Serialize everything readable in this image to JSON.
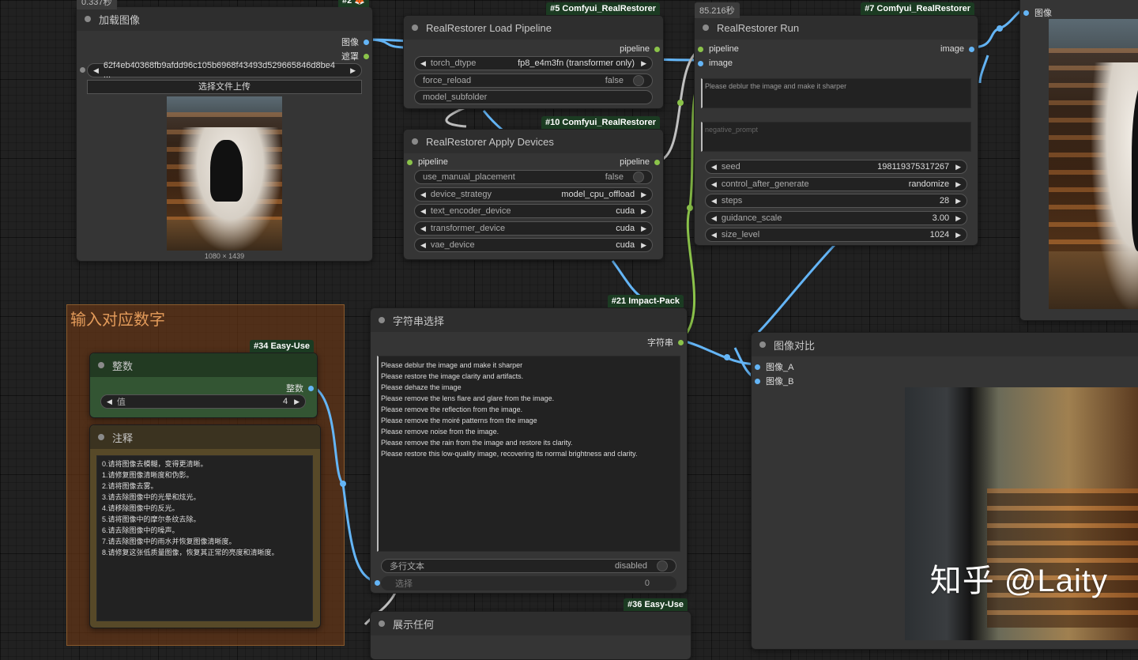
{
  "load_image": {
    "timer": "0.337秒",
    "badge": "#2 ",
    "title": "加载图像",
    "outputs": [
      "图像",
      "遮罩"
    ],
    "file_value": "62f4eb40368fb9afdd96c105b6968f43493d529665846d8be4 ...",
    "upload_label": "选择文件上传",
    "image_size": "1080 × 1439"
  },
  "load_pipeline": {
    "badge": "#5 Comfyui_RealRestorer",
    "title": "RealRestorer Load Pipeline",
    "output": "pipeline",
    "widgets": [
      {
        "label": "torch_dtype",
        "value": "fp8_e4m3fn (transformer only)"
      },
      {
        "label": "force_reload",
        "value": "false"
      },
      {
        "label": "model_subfolder",
        "value": ""
      }
    ]
  },
  "apply_devices": {
    "badge": "#10 Comfyui_RealRestorer",
    "title": "RealRestorer Apply Devices",
    "input": "pipeline",
    "output": "pipeline",
    "widgets": [
      {
        "label": "use_manual_placement",
        "value": "false"
      },
      {
        "label": "device_strategy",
        "value": "model_cpu_offload"
      },
      {
        "label": "text_encoder_device",
        "value": "cuda"
      },
      {
        "label": "transformer_device",
        "value": "cuda"
      },
      {
        "label": "vae_device",
        "value": "cuda"
      }
    ]
  },
  "run": {
    "timer": "85.216秒",
    "badge": "#7 Comfyui_RealRestorer",
    "title": "RealRestorer Run",
    "inputs": [
      "pipeline",
      "image"
    ],
    "output": "image",
    "prompt": "Please deblur the image and make it sharper",
    "negative_placeholder": "negative_prompt",
    "widgets": [
      {
        "label": "seed",
        "value": "198119375317267"
      },
      {
        "label": "control_after_generate",
        "value": "randomize"
      },
      {
        "label": "steps",
        "value": "28"
      },
      {
        "label": "guidance_scale",
        "value": "3.00"
      },
      {
        "label": "size_level",
        "value": "1024"
      }
    ]
  },
  "preview": {
    "input": "图像"
  },
  "group": {
    "title": "输入对应数字"
  },
  "integer": {
    "badge": "#34 Easy-Use",
    "title": "整数",
    "output": "整数",
    "widget_label": "值",
    "widget_value": "4"
  },
  "note": {
    "title": "注释",
    "lines": [
      "0.请将图像去模糊，变得更清晰。",
      "1.请修复图像清晰度和伪影。",
      "2.请将图像去雾。",
      "3.请去除图像中的光晕和炫光。",
      "4.请移除图像中的反光。",
      "5.请将图像中的摩尔条纹去除。",
      "6.请去除图像中的噪声。",
      "7.请去除图像中的雨水并恢复图像清晰度。",
      "8.请修复这张低质量图像，恢复其正常的亮度和清晰度。"
    ]
  },
  "string_select": {
    "badge": "#21 Impact-Pack",
    "title": "字符串选择",
    "output": "字符串",
    "lines": [
      "Please deblur the image and make it sharper",
      "Please restore the image clarity and artifacts.",
      "Please dehaze the image",
      "Please remove the lens flare and glare from the image.",
      "Please remove the reflection from the image.",
      "Please remove the moiré patterns from the image",
      "Please remove noise from the image.",
      "Please remove the rain from the image and restore its clarity.",
      "Please restore this low-quality image, recovering its normal brightness and clarity."
    ],
    "multiline_label": "多行文本",
    "multiline_value": "disabled",
    "select_label": "选择",
    "select_value": "0"
  },
  "compare": {
    "title": "图像对比",
    "inputs": [
      "图像_A",
      "图像_B"
    ]
  },
  "show_any": {
    "badge": "#36 Easy-Use",
    "title": "展示任何"
  },
  "watermark": "知乎 @Laity",
  "colors": {
    "canvas": "#212121",
    "node": "#353535",
    "badge": "#1b3b22",
    "wire_image": "#64b5f6",
    "wire_string": "#8bc34a",
    "wire_pipeline": "#c0c0c0",
    "group": "#783c14"
  }
}
